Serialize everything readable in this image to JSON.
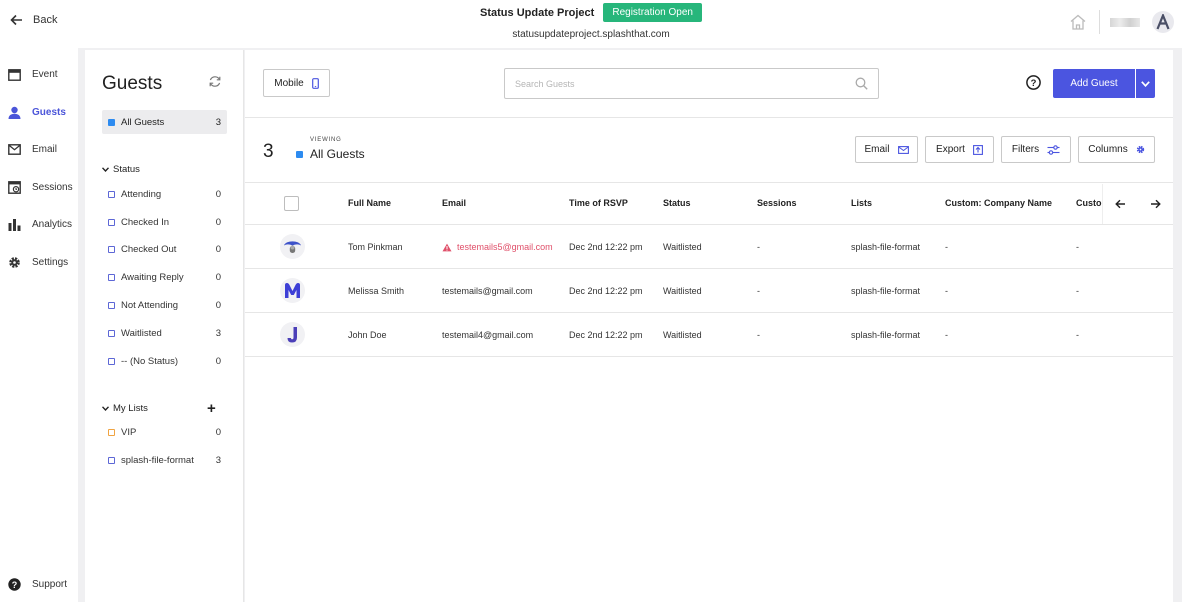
{
  "topbar": {
    "back_label": "Back",
    "event_name": "Status Update Project",
    "registration_status": "Registration Open",
    "event_url": "statusupdateproject.splashthat.com"
  },
  "nav": {
    "items": [
      {
        "label": "Event",
        "icon": "calendar-icon"
      },
      {
        "label": "Guests",
        "icon": "user-icon",
        "active": true
      },
      {
        "label": "Email",
        "icon": "mail-icon"
      },
      {
        "label": "Sessions",
        "icon": "sessions-icon"
      },
      {
        "label": "Analytics",
        "icon": "bar-chart-icon"
      },
      {
        "label": "Settings",
        "icon": "gear-icon"
      }
    ],
    "support_label": "Support"
  },
  "sidebar": {
    "title": "Guests",
    "all_guests": {
      "label": "All Guests",
      "count": "3"
    },
    "status_title": "Status",
    "status_items": [
      {
        "label": "Attending",
        "count": "0"
      },
      {
        "label": "Checked In",
        "count": "0"
      },
      {
        "label": "Checked Out",
        "count": "0"
      },
      {
        "label": "Awaiting Reply",
        "count": "0"
      },
      {
        "label": "Not Attending",
        "count": "0"
      },
      {
        "label": "Waitlisted",
        "count": "3"
      },
      {
        "label": "-- (No Status)",
        "count": "0"
      }
    ],
    "lists_title": "My Lists",
    "list_items": [
      {
        "label": "VIP",
        "count": "0"
      },
      {
        "label": "splash-file-format",
        "count": "3"
      }
    ]
  },
  "toolbar": {
    "mobile_label": "Mobile",
    "search_placeholder": "Search Guests",
    "add_guest_label": "Add Guest"
  },
  "viewing": {
    "count": "3",
    "caption": "VIEWING",
    "name": "All Guests",
    "email_label": "Email",
    "export_label": "Export",
    "filters_label": "Filters",
    "columns_label": "Columns"
  },
  "table": {
    "headers": [
      "Full Name",
      "Email",
      "Time of RSVP",
      "Status",
      "Sessions",
      "Lists",
      "Custom: Company Name",
      "Custon"
    ],
    "rows": [
      {
        "name": "Tom Pinkman",
        "email": "testemails5@gmail.com",
        "email_error": true,
        "rsvp": "Dec 2nd 12:22 pm",
        "status": "Waitlisted",
        "sessions": "-",
        "lists": "splash-file-format",
        "company": "-",
        "custom2": "-"
      },
      {
        "name": "Melissa Smith",
        "email": "testemails@gmail.com",
        "email_error": false,
        "rsvp": "Dec 2nd 12:22 pm",
        "status": "Waitlisted",
        "sessions": "-",
        "lists": "splash-file-format",
        "company": "-",
        "custom2": "-"
      },
      {
        "name": "John Doe",
        "email": "testemail4@gmail.com",
        "email_error": false,
        "rsvp": "Dec 2nd 12:22 pm",
        "status": "Waitlisted",
        "sessions": "-",
        "lists": "splash-file-format",
        "company": "-",
        "custom2": "-"
      }
    ]
  },
  "colors": {
    "accent": "#4b55e0",
    "registration_badge": "#27b67b",
    "error": "#e0506a"
  }
}
